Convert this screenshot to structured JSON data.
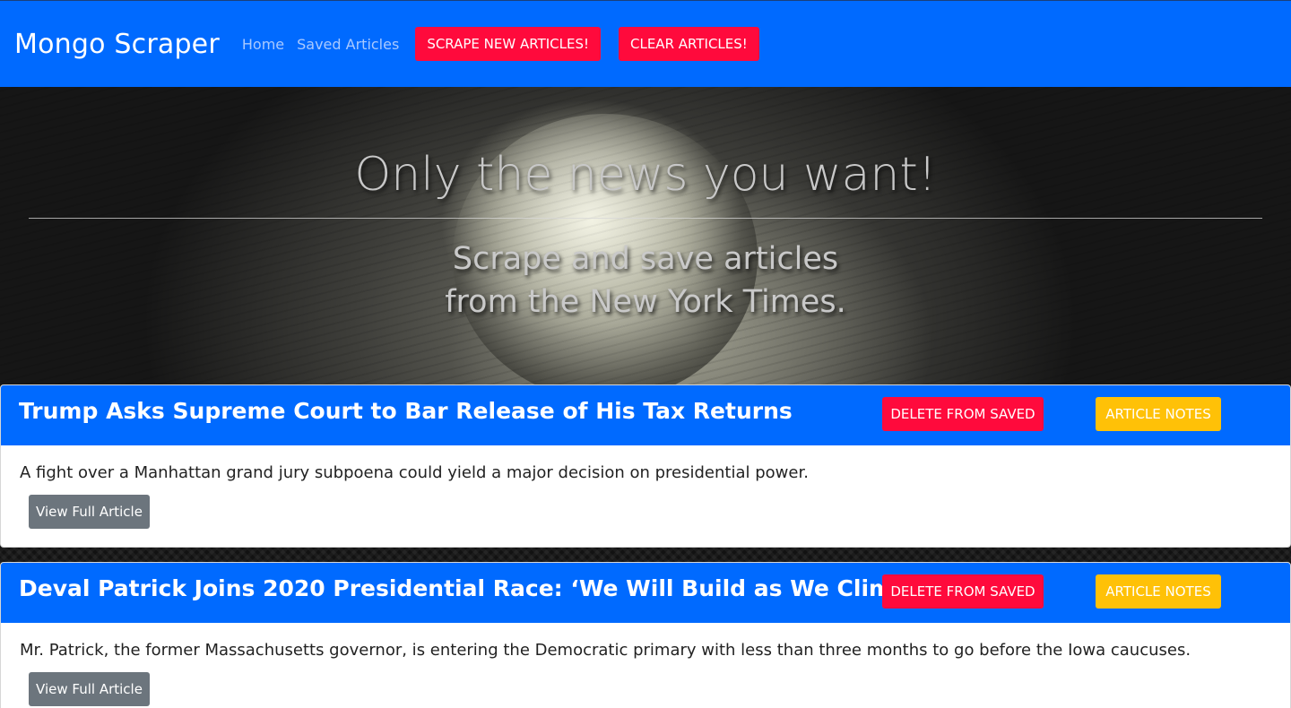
{
  "navbar": {
    "brand": "Mongo Scraper",
    "links": [
      "Home",
      "Saved Articles"
    ],
    "scrape_label": "SCRAPE NEW ARTICLES!",
    "clear_label": "CLEAR ARTICLES!"
  },
  "hero": {
    "title": "Only the news you want!",
    "subtitle_line1": "Scrape and save articles",
    "subtitle_line2": "from the New York Times."
  },
  "articles": [
    {
      "title": "Trump Asks Supreme Court to Bar Release of His Tax Returns",
      "summary": "A fight over a Manhattan grand jury subpoena could yield a major decision on presidential power.",
      "delete_label": "DELETE FROM SAVED",
      "notes_label": "ARTICLE NOTES",
      "view_label": "View Full Article"
    },
    {
      "title": "Deval Patrick Joins 2020 Presidential Race: ‘We Will Build as We Climb’",
      "summary": "Mr. Patrick, the former Massachusetts governor, is entering the Democratic primary with less than three months to go before the Iowa caucuses.",
      "delete_label": "DELETE FROM SAVED",
      "notes_label": "ARTICLE NOTES",
      "view_label": "View Full Article"
    }
  ],
  "colors": {
    "primary": "#006aff",
    "danger": "#ff0a3c",
    "warning": "#ffc107",
    "secondary": "#6c757d"
  }
}
